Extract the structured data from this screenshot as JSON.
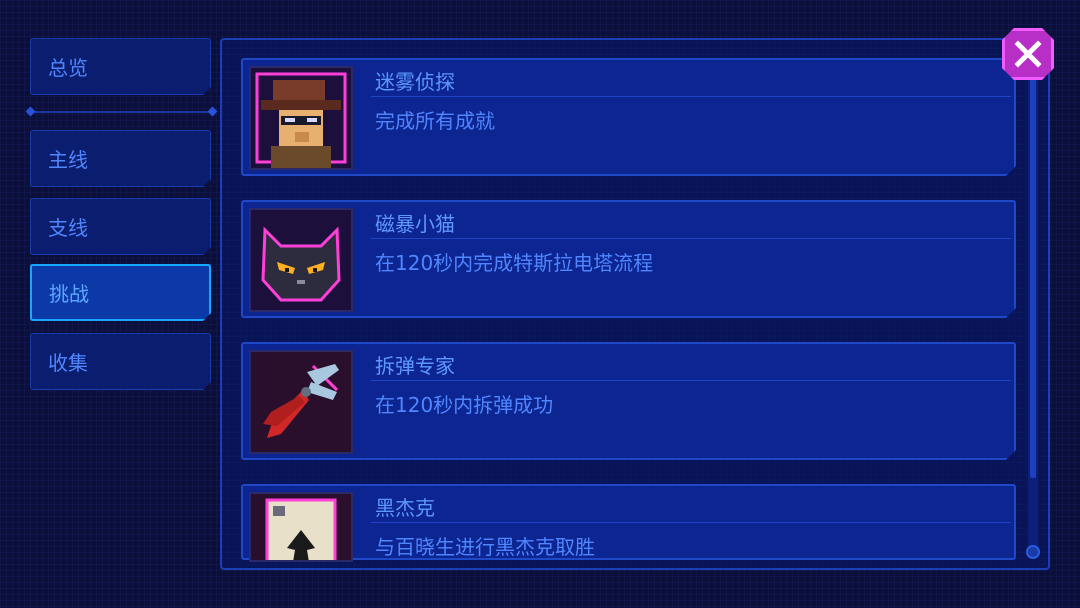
{
  "sidebar": {
    "tabs": [
      {
        "label": "总览",
        "active": false
      },
      {
        "label": "主线",
        "active": false
      },
      {
        "label": "支线",
        "active": false
      },
      {
        "label": "挑战",
        "active": true
      },
      {
        "label": "收集",
        "active": false
      }
    ]
  },
  "achievements": [
    {
      "title": "迷雾侦探",
      "description": "完成所有成就",
      "icon": "detective-icon"
    },
    {
      "title": "磁暴小猫",
      "description": "在120秒内完成特斯拉电塔流程",
      "icon": "black-cat-icon"
    },
    {
      "title": "拆弹专家",
      "description": "在120秒内拆弹成功",
      "icon": "pliers-icon"
    },
    {
      "title": "黑杰克",
      "description": "与百晓生进行黑杰克取胜",
      "icon": "playing-card-icon"
    }
  ],
  "colors": {
    "background": "#0b0f3a",
    "accent": "#19a6ff",
    "text": "#4f86ff",
    "close": "#b82fc8"
  }
}
